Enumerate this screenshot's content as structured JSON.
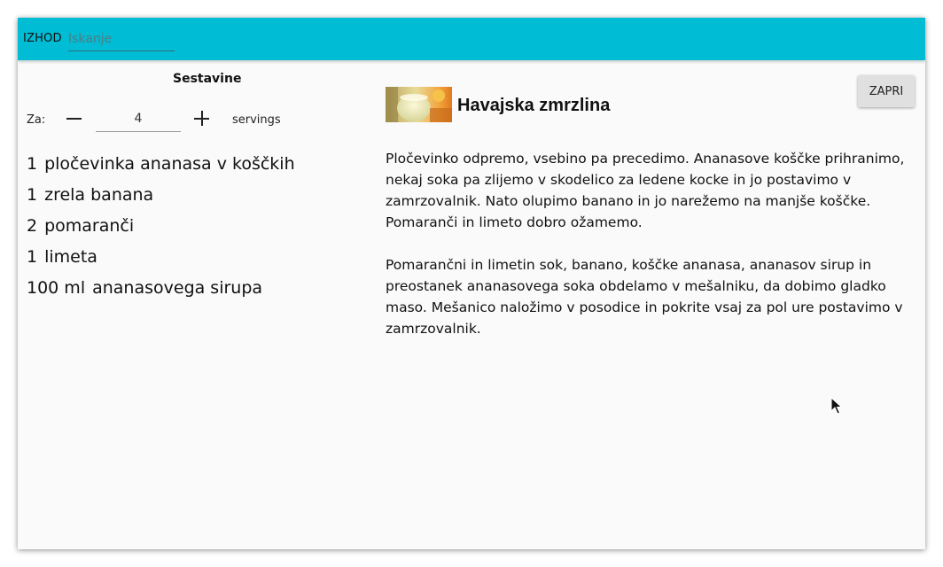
{
  "topbar": {
    "exit_label": "IZHOD",
    "search_placeholder": "Iskanje",
    "search_value": ""
  },
  "ingredients_panel": {
    "title": "Sestavine",
    "for_label": "Za:",
    "servings_value": "4",
    "servings_label": "servings",
    "items": [
      {
        "amount": "1",
        "name": "pločevinka ananasa v koščkih"
      },
      {
        "amount": "1",
        "name": "zrela banana"
      },
      {
        "amount": "2",
        "name": "pomaranči"
      },
      {
        "amount": "1",
        "name": "limeta"
      },
      {
        "amount": "100 ml",
        "name": "ananasovega sirupa"
      }
    ]
  },
  "recipe": {
    "title": "Havajska zmrzlina",
    "close_label": "ZAPRI",
    "paragraphs": [
      "Pločevinko odpremo, vsebino pa precedimo. Ananasove koščke prihranimo, nekaj soka pa zlijemo v skodelico za ledene kocke in jo postavimo v zamrzovalnik. Nato olupimo banano in jo narežemo na manjše koščke. Pomaranči in limeto dobro ožamemo.",
      "Pomarančni in limetin sok, banano, koščke ananasa, ananasov sirup in preostanek ananasovega soka obdelamo v mešalniku, da dobimo gladko maso. Mešanico naložimo v posodice in pokrite vsaj za pol ure postavimo v zamrzovalnik."
    ]
  },
  "colors": {
    "topbar": "#00bcd4",
    "background": "#fafafa",
    "button": "#e0e0e0"
  }
}
